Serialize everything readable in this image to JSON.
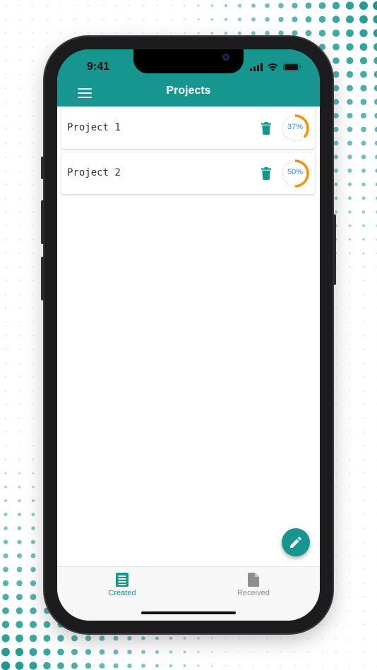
{
  "status_bar": {
    "time": "9:41"
  },
  "header": {
    "title": "Projects"
  },
  "projects": [
    {
      "name": "Project 1",
      "progress": 37,
      "progress_label": "37%"
    },
    {
      "name": "Project 2",
      "progress": 50,
      "progress_label": "50%"
    }
  ],
  "tabs": [
    {
      "label": "Created",
      "icon": "list-document-icon",
      "active": true
    },
    {
      "label": "Received",
      "icon": "document-icon",
      "active": false
    }
  ],
  "fab": {
    "icon": "pencil-icon"
  },
  "colors": {
    "primary": "#17968f",
    "progress_ring": "#f39200",
    "progress_text": "#3a8ed8",
    "inactive_tab": "#8e8e8e"
  }
}
